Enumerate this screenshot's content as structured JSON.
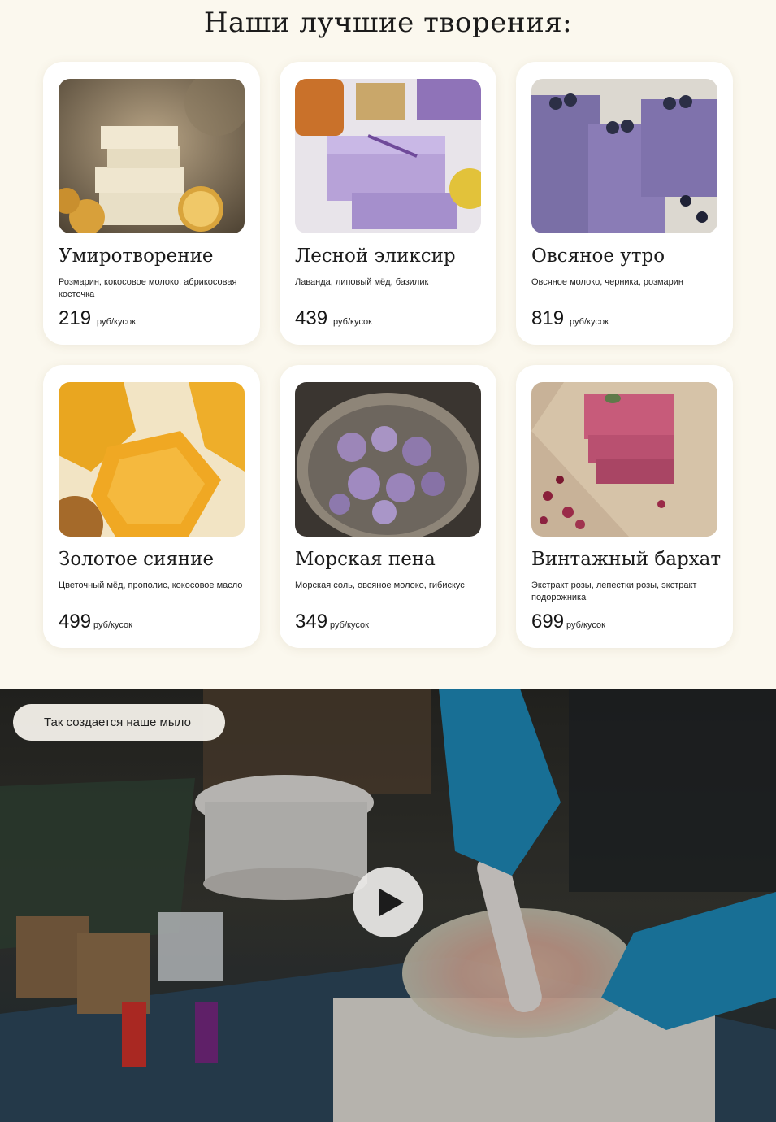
{
  "section": {
    "title": "Наши лучшие творения:"
  },
  "products": [
    {
      "name": "Умиротворение",
      "description": "Розмарин, кокосовое молоко, абрикосовая косточка",
      "price": "219",
      "unit": "руб/кусок"
    },
    {
      "name": "Лесной эликсир",
      "description": "Лаванда, липовый мёд, базилик",
      "price": "439",
      "unit": "руб/кусок"
    },
    {
      "name": "Овсяное утро",
      "description": "Овсяное молоко, черника, розмарин",
      "price": "819",
      "unit": "руб/кусок"
    },
    {
      "name": "Золотое сияние",
      "description": "Цветочный мёд, прополис, кокосовое масло",
      "price": "499",
      "unit": "руб/кусок"
    },
    {
      "name": "Морская пена",
      "description": "Морская соль, овсяное молоко, гибискус",
      "price": "349",
      "unit": "руб/кусок"
    },
    {
      "name": "Винтажный бархат",
      "description": "Экстракт розы, лепестки розы, экстракт подорожника",
      "price": "699",
      "unit": "руб/кусок"
    }
  ],
  "video": {
    "badge": "Так создается наше мыло",
    "play_icon": "play-icon"
  },
  "colors": {
    "background": "#fbf8ee",
    "card": "#ffffff",
    "text": "#1b1b1b"
  }
}
